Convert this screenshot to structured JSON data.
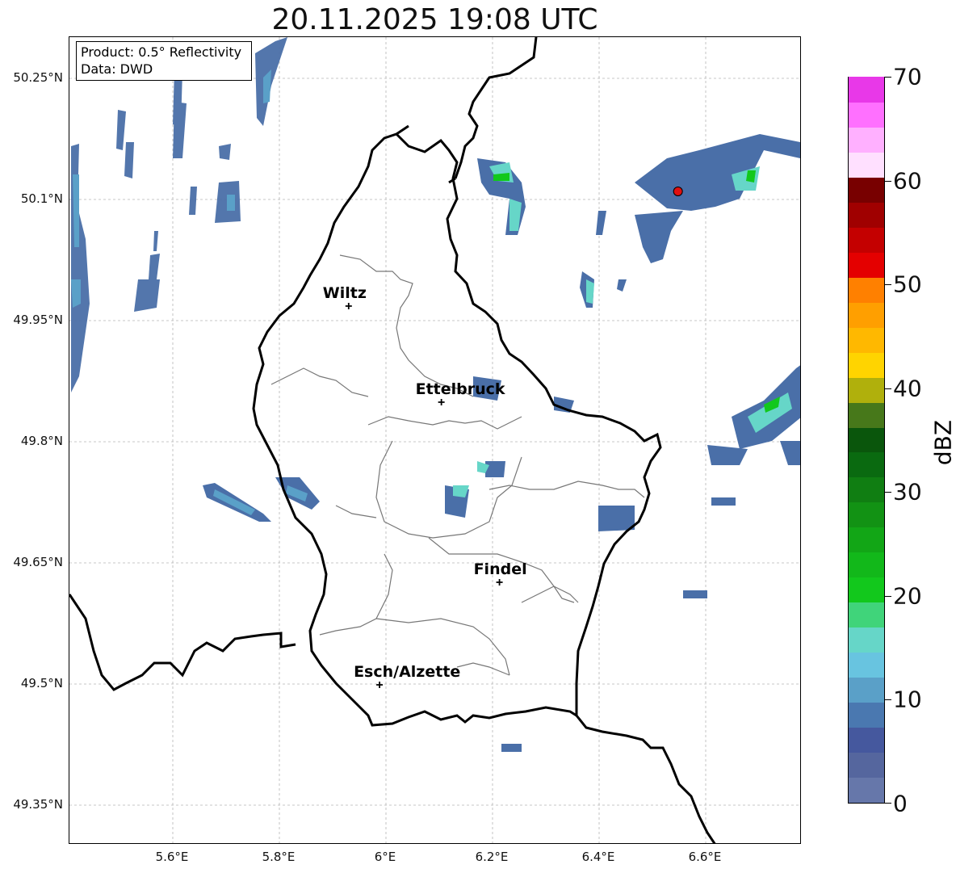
{
  "title": "20.11.2025 19:08 UTC",
  "info": {
    "product": "Product: 0.5° Reflectivity",
    "data_source": "Data: DWD"
  },
  "lat_ticks": [
    {
      "label": "50.25°N",
      "lat": 50.25
    },
    {
      "label": "50.1°N",
      "lat": 50.1
    },
    {
      "label": "49.95°N",
      "lat": 49.95
    },
    {
      "label": "49.8°N",
      "lat": 49.8
    },
    {
      "label": "49.65°N",
      "lat": 49.65
    },
    {
      "label": "49.5°N",
      "lat": 49.5
    },
    {
      "label": "49.35°N",
      "lat": 49.35
    }
  ],
  "lon_ticks": [
    {
      "label": "5.6°E",
      "lon": 5.6
    },
    {
      "label": "5.8°E",
      "lon": 5.8
    },
    {
      "label": "6°E",
      "lon": 6.0
    },
    {
      "label": "6.2°E",
      "lon": 6.2
    },
    {
      "label": "6.4°E",
      "lon": 6.4
    },
    {
      "label": "6.6°E",
      "lon": 6.6
    }
  ],
  "cities": [
    {
      "name": "Wiltz",
      "lat": 49.968,
      "lon": 5.93
    },
    {
      "name": "Ettelbruck",
      "lat": 49.849,
      "lon": 6.104
    },
    {
      "name": "Findel",
      "lat": 49.626,
      "lon": 6.213
    },
    {
      "name": "Esch/Alzette",
      "lat": 49.499,
      "lon": 5.988
    }
  ],
  "radar_site": {
    "lat": 50.11,
    "lon": 6.548,
    "color": "#e01010"
  },
  "colorbar": {
    "label": "dBZ",
    "min": 0,
    "max": 70,
    "step": 2.5,
    "tick_labels": [
      "0",
      "10",
      "20",
      "30",
      "40",
      "50",
      "60",
      "70"
    ],
    "colors": [
      "#6677aa",
      "#55669e",
      "#45589e",
      "#4a78b0",
      "#5aa0c8",
      "#68c4e0",
      "#66d6c8",
      "#40d47a",
      "#12c81c",
      "#12b81a",
      "#12a616",
      "#129214",
      "#107e12",
      "#0a6a10",
      "#0a560c",
      "#47781a",
      "#b0b00c",
      "#ffd400",
      "#ffb800",
      "#ff9f00",
      "#ff8000",
      "#e40000",
      "#c40000",
      "#a00000",
      "#780000",
      "#ffe0ff",
      "#ffb0ff",
      "#ff70ff",
      "#e838e8"
    ]
  }
}
